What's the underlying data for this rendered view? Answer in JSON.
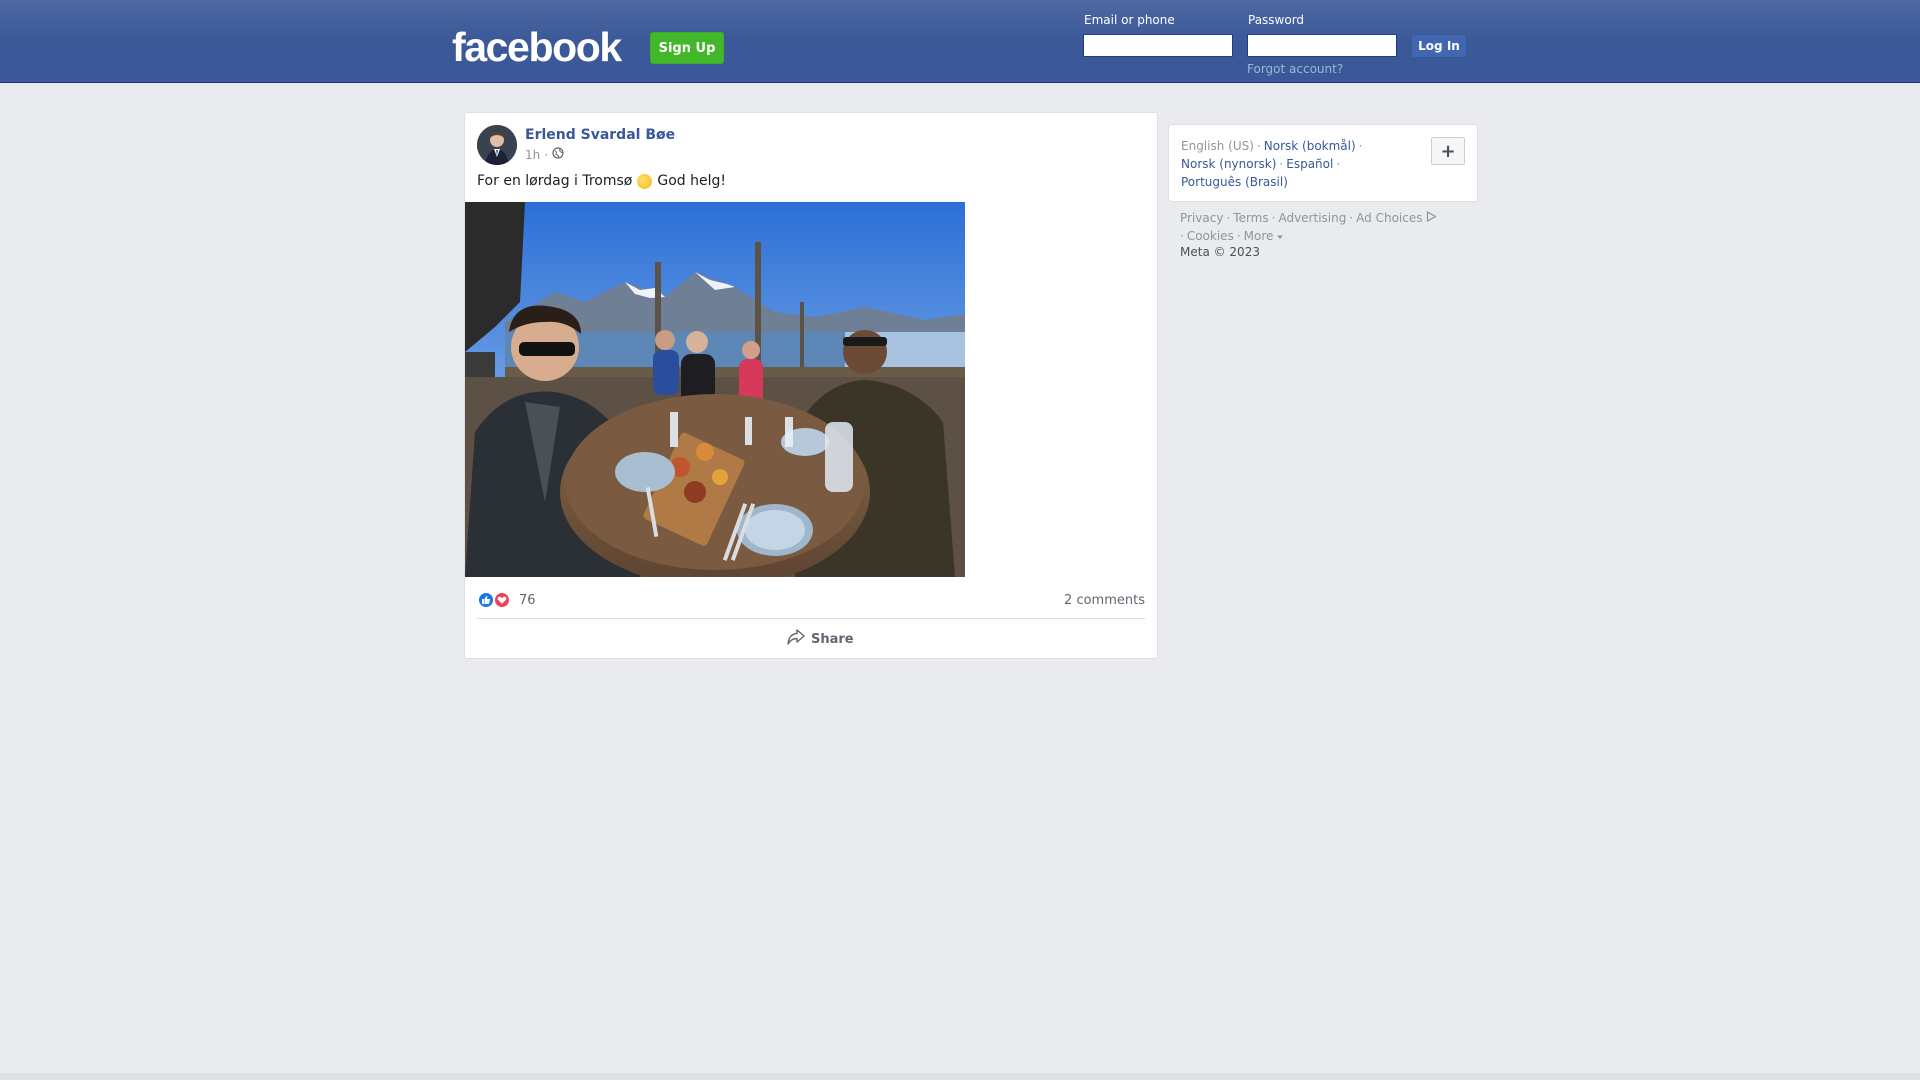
{
  "header": {
    "logo_text": "facebook",
    "signup_label": "Sign Up",
    "email_label": "Email or phone",
    "password_label": "Password",
    "login_label": "Log In",
    "forgot_label": "Forgot account?"
  },
  "post": {
    "author": "Erlend Svardal Bøe",
    "time": "1h",
    "privacy_icon": "globe-icon",
    "text_before": "For en lørdag i Tromsø",
    "emoji": "sun-emoji",
    "text_after": "God helg!",
    "reaction_count": "76",
    "comments_label": "2 comments",
    "share_label": "Share"
  },
  "languages": {
    "current": "English (US)",
    "items": [
      "Norsk (bokmål)",
      "Norsk (nynorsk)",
      "Español",
      "Português (Brasil)"
    ],
    "add_label": "+"
  },
  "footer": {
    "links": [
      "Privacy",
      "Terms",
      "Advertising",
      "Ad Choices",
      "Cookies",
      "More"
    ],
    "copyright": "Meta © 2023"
  },
  "colors": {
    "brand_blue": "#3b5998",
    "signup_green": "#42b72a",
    "link_blue": "#385898",
    "page_bg": "#e9ebee"
  }
}
